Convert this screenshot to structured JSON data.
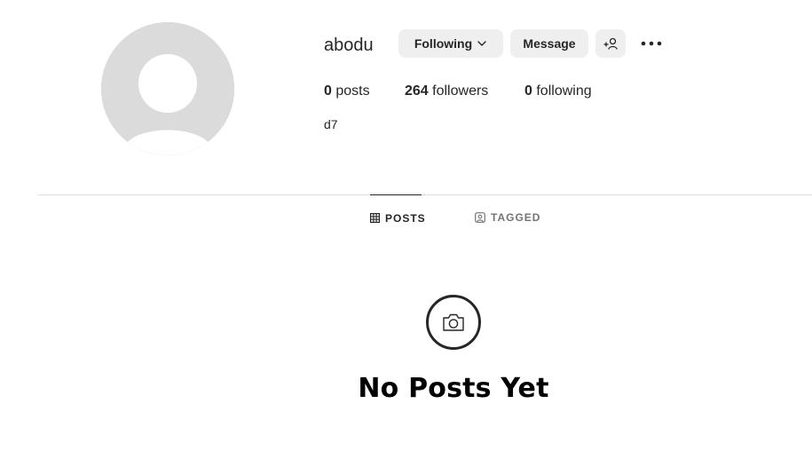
{
  "profile": {
    "username": "abodu",
    "bio": "d7"
  },
  "actions": {
    "following_label": "Following",
    "message_label": "Message"
  },
  "stats": {
    "posts_count": "0",
    "posts_label": "posts",
    "followers_count": "264",
    "followers_label": "followers",
    "following_count": "0",
    "following_label": "following"
  },
  "tabs": [
    {
      "label": "POSTS",
      "icon": "grid-icon",
      "active": true
    },
    {
      "label": "TAGGED",
      "icon": "tagged-icon",
      "active": false
    }
  ],
  "empty_state": {
    "icon": "camera-icon",
    "title": "No Posts Yet"
  },
  "colors": {
    "text": "#262626",
    "button_bg": "#efefef",
    "divider": "#dbdbdb",
    "muted": "#737373",
    "avatar_bg": "#dbdbdb"
  }
}
